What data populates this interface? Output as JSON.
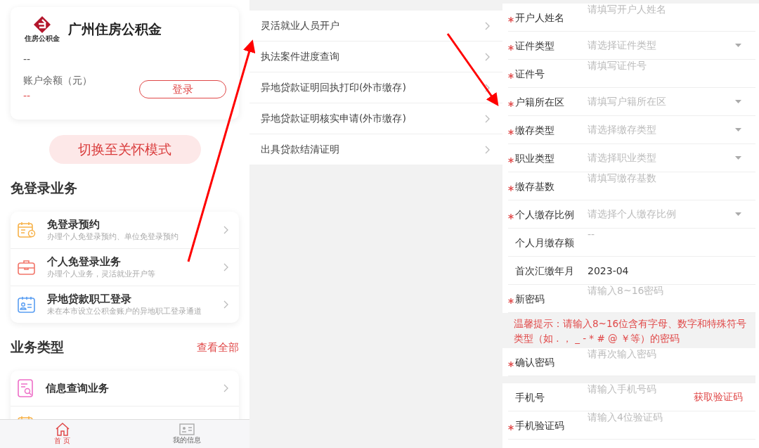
{
  "home": {
    "brand": {
      "name": "广州住房公积金",
      "logo_caption": "住房公积金"
    },
    "account": {
      "name": "--",
      "balance_label": "账户余额（元）",
      "balance": "--",
      "login_button": "登录"
    },
    "care_mode_button": "切换至关怀模式",
    "no_login_section": {
      "title": "免登录业务",
      "items": [
        {
          "kind": "calendar",
          "title": "免登录预约",
          "subtitle": "办理个人免登录预约、单位免登录预约"
        },
        {
          "kind": "briefcase",
          "title": "个人免登录业务",
          "subtitle": "办理个人业务，灵活就业开户等"
        },
        {
          "kind": "idcard",
          "title": "异地贷款职工登录",
          "subtitle": "未在本市设立公积金账户的异地职工登录通道"
        }
      ]
    },
    "business_section": {
      "title": "业务类型",
      "link": "查看全部",
      "items": [
        {
          "kind": "search",
          "title": "信息查询业务"
        },
        {
          "kind": "calendar"
        }
      ]
    },
    "tabs": [
      {
        "label": "首 页",
        "kind": "home",
        "selected": true
      },
      {
        "label": "我的信息",
        "kind": "card",
        "selected": false
      }
    ]
  },
  "personal_list": [
    {
      "label": "灵活就业人员开户"
    },
    {
      "label": "执法案件进度查询"
    },
    {
      "label": "异地贷款证明回执打印(外市缴存)"
    },
    {
      "label": "异地贷款证明核实申请(外市缴存)"
    },
    {
      "label": "出具贷款结清证明"
    }
  ],
  "form": {
    "fields": [
      {
        "kind": "input",
        "required": true,
        "label": "开户人姓名",
        "placeholder": "请填写开户人姓名"
      },
      {
        "kind": "select",
        "required": true,
        "label": "证件类型",
        "placeholder": "请选择证件类型"
      },
      {
        "kind": "input",
        "required": true,
        "label": "证件号",
        "placeholder": "请填写证件号"
      },
      {
        "kind": "select",
        "required": true,
        "label": "户籍所在区",
        "placeholder": "请填写户籍所在区"
      },
      {
        "kind": "select",
        "required": true,
        "label": "缴存类型",
        "placeholder": "请选择缴存类型"
      },
      {
        "kind": "select",
        "required": true,
        "label": "职业类型",
        "placeholder": "请选择职业类型"
      },
      {
        "kind": "input",
        "required": true,
        "label": "缴存基数",
        "placeholder": "请填写缴存基数"
      },
      {
        "kind": "select",
        "required": true,
        "label": "个人缴存比例",
        "placeholder": "请选择个人缴存比例"
      },
      {
        "kind": "input",
        "required": false,
        "label": "个人月缴存额",
        "placeholder": "--"
      },
      {
        "kind": "value",
        "required": false,
        "label": "首次汇缴年月",
        "value": "2023-04"
      },
      {
        "kind": "input",
        "required": true,
        "label": "新密码",
        "placeholder": "请输入8~16密码"
      },
      {
        "kind": "tip",
        "text": "温馨提示：请输入8~16位含有字母、数字和特殊符号类型（如 . ， _ - * # @ ￥等）的密码"
      },
      {
        "kind": "input",
        "required": true,
        "label": "确认密码",
        "placeholder": "请再次输入密码"
      },
      {
        "kind": "gap"
      },
      {
        "kind": "input",
        "required": false,
        "label": "手机号",
        "placeholder": "请输入手机号码",
        "action": "获取验证码"
      },
      {
        "kind": "input",
        "required": true,
        "label": "手机验证码",
        "placeholder": "请输入4位验证码"
      }
    ]
  }
}
